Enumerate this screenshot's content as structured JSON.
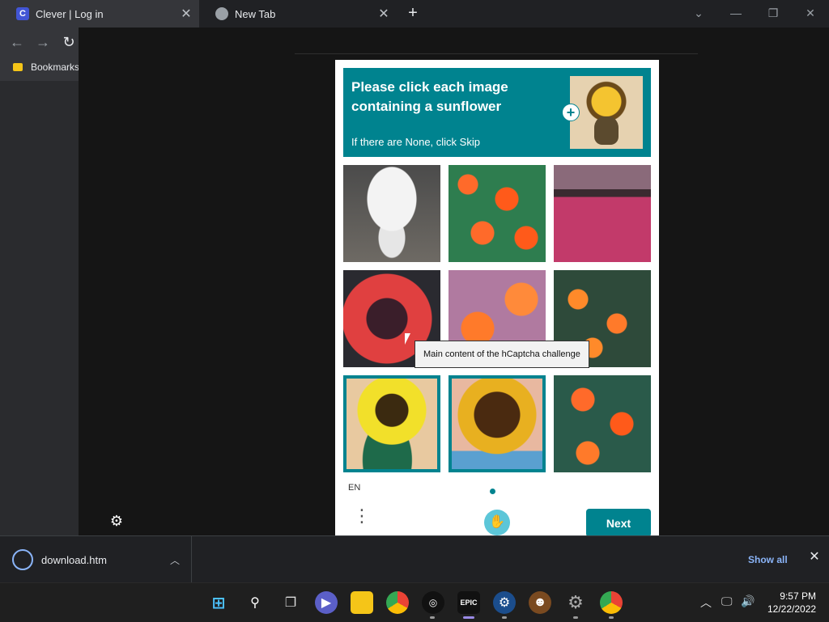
{
  "browser": {
    "tabs": [
      {
        "title": "Clever | Log in",
        "favicon": "clever-icon",
        "active": true
      },
      {
        "title": "New Tab",
        "favicon": "chrome-icon",
        "active": false
      }
    ],
    "bookmarks_label": "Bookmarks",
    "accent": "#8ab4f8"
  },
  "captcha": {
    "prompt": "Please click each image containing a sunflower",
    "sub": "If there are None, click Skip",
    "images": [
      {
        "name": "daisies-in-vase",
        "selected": false
      },
      {
        "name": "orange-tulips",
        "selected": false
      },
      {
        "name": "pink-flower-field",
        "selected": false
      },
      {
        "name": "red-flower-closeup",
        "selected": false
      },
      {
        "name": "blurry-tulips",
        "selected": false
      },
      {
        "name": "tulip-field",
        "selected": false
      },
      {
        "name": "sunflower-in-vase",
        "selected": true
      },
      {
        "name": "sunflower-closeup",
        "selected": true
      },
      {
        "name": "tulip-field-2",
        "selected": false
      }
    ],
    "tooltip": "Main content of the hCaptcha challenge",
    "language": "EN",
    "next_label": "Next",
    "accent": "#00838f"
  },
  "downloads": {
    "file": "download.htm",
    "show_all": "Show all"
  },
  "taskbar": {
    "time": "9:57 PM",
    "date": "12/22/2022",
    "apps": [
      "windows-start-icon",
      "search-icon",
      "task-view-icon",
      "meet-icon",
      "file-explorer-icon",
      "chrome-icon",
      "app-icon",
      "epic-games-icon",
      "steam-icon",
      "game-icon",
      "settings-icon",
      "chrome-profile-icon"
    ]
  }
}
